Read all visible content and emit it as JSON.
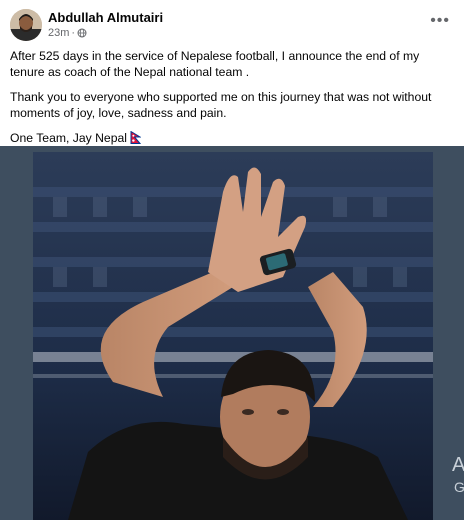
{
  "post": {
    "author": "Abdullah Almutairi",
    "time": "23m",
    "separator": "·",
    "privacy_icon": "globe-icon",
    "more_icon": "more-options-icon",
    "more_label": "•••",
    "paragraphs": [
      "After 525 days in the service of Nepalese football, I announce the end of my tenure as coach of the Nepal national team .",
      "Thank you to everyone who supported me on this journey that was not without moments of joy, love, sadness and pain."
    ],
    "closing_text": "One Team, Jay Nepal",
    "closing_emoji_icon": "nepal-flag-icon"
  },
  "media": {
    "side_text_large": "A",
    "side_text_small": "G"
  },
  "colors": {
    "name": "#050505",
    "meta": "#65676b",
    "media_background": "#3e4e5f",
    "flag_red": "#dc143c",
    "flag_blue": "#003893"
  }
}
